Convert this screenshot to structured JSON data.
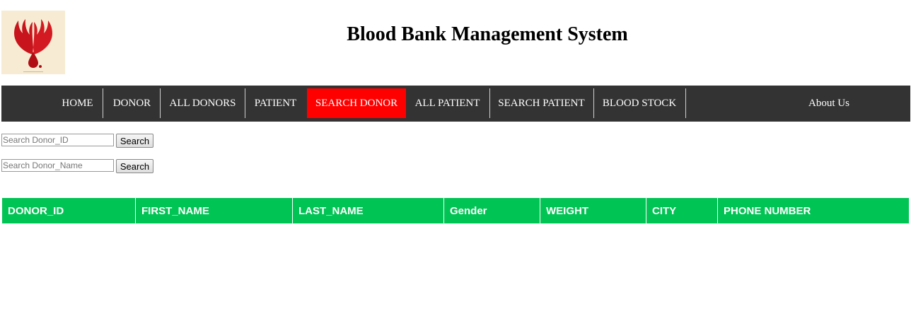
{
  "header": {
    "title": "Blood Bank Management System",
    "logo_icon": "blood-drop-hands-icon"
  },
  "nav": {
    "items": [
      {
        "label": "HOME",
        "active": false
      },
      {
        "label": "DONOR",
        "active": false
      },
      {
        "label": "ALL DONORS",
        "active": false
      },
      {
        "label": "PATIENT",
        "active": false
      },
      {
        "label": "SEARCH DONOR",
        "active": true
      },
      {
        "label": "ALL PATIENT",
        "active": false
      },
      {
        "label": "SEARCH PATIENT",
        "active": false
      },
      {
        "label": "BLOOD STOCK",
        "active": false
      },
      {
        "label": "About Us",
        "active": false
      }
    ],
    "background_color": "#333333",
    "active_color": "#ff0000"
  },
  "search": {
    "by_id": {
      "placeholder": "Search Donor_ID",
      "value": "",
      "button_label": "Search"
    },
    "by_name": {
      "placeholder": "Search Donor_Name",
      "value": "",
      "button_label": "Search"
    }
  },
  "table": {
    "header_color": "#00c453",
    "columns": [
      "DONOR_ID",
      "FIRST_NAME",
      "LAST_NAME",
      "Gender",
      "WEIGHT",
      "CITY",
      "PHONE NUMBER"
    ],
    "rows": []
  }
}
